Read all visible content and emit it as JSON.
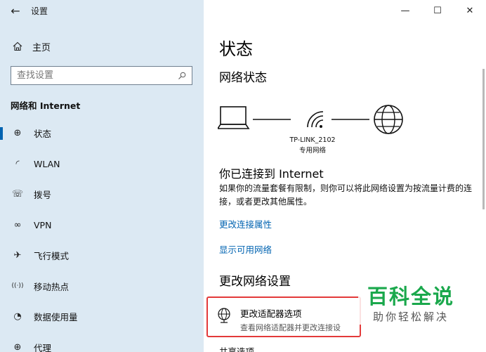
{
  "window": {
    "back_glyph": "←",
    "title": "设置",
    "minimize": "—",
    "maximize": "☐",
    "close": "✕"
  },
  "sidebar": {
    "home_label": "主页",
    "search_placeholder": "查找设置",
    "section_title": "网络和 Internet",
    "items": [
      {
        "label": "状态",
        "icon": "globe-icon",
        "glyph": "⊕",
        "active": true
      },
      {
        "label": "WLAN",
        "icon": "wifi-icon",
        "glyph": "◜"
      },
      {
        "label": "拨号",
        "icon": "dialup-icon",
        "glyph": "☏"
      },
      {
        "label": "VPN",
        "icon": "vpn-icon",
        "glyph": "∞"
      },
      {
        "label": "飞行模式",
        "icon": "airplane-icon",
        "glyph": "✈"
      },
      {
        "label": "移动热点",
        "icon": "hotspot-icon",
        "glyph": "((·))"
      },
      {
        "label": "数据使用量",
        "icon": "data-usage-icon",
        "glyph": "◔"
      },
      {
        "label": "代理",
        "icon": "proxy-icon",
        "glyph": "⊕"
      }
    ]
  },
  "main": {
    "page_title": "状态",
    "network_status_title": "网络状态",
    "network_name": "TP-LINK_2102",
    "network_type": "专用网络",
    "connected_title": "你已连接到 Internet",
    "description": "如果你的流量套餐有限制，则你可以将此网络设置为按流量计费的连接，或者更改其他属性。",
    "link_change_properties": "更改连接属性",
    "link_show_networks": "显示可用网络",
    "change_settings_title": "更改网络设置",
    "adapter_title": "更改适配器选项",
    "adapter_desc": "查看网络适配器并更改连接设",
    "next_item": "共享选项"
  },
  "watermark": {
    "line1": "百科全说",
    "line2": "助你轻松解决"
  },
  "colors": {
    "sidebar_bg": "#dce9f3",
    "accent": "#0063b1",
    "highlight": "#e33a3a",
    "watermark_green": "#1aa84c"
  }
}
